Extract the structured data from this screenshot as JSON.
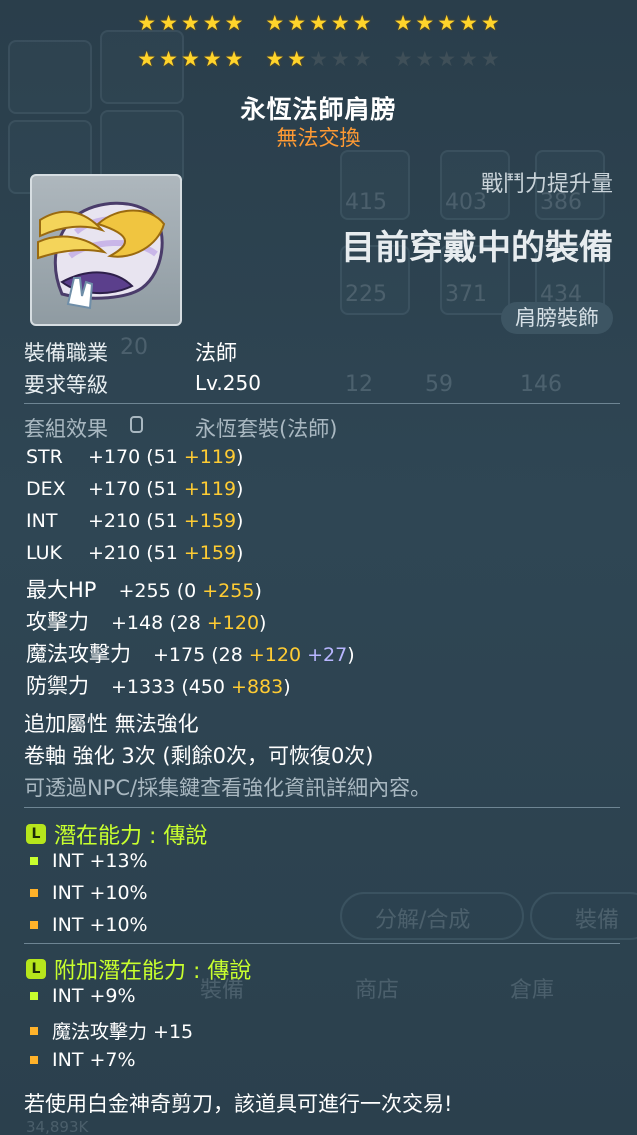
{
  "stars": {
    "filled": 22,
    "total": 30
  },
  "item": {
    "name": "永恆法師肩膀",
    "trade_status": "無法交換"
  },
  "combat": {
    "title": "戰鬥力提升量",
    "equipped_label": "目前穿戴中的裝備",
    "slot": "肩膀裝飾"
  },
  "requirements": {
    "job_label": "裝備職業",
    "job_value": "法師",
    "level_label": "要求等級",
    "level_value": "Lv.250"
  },
  "set": {
    "label": "套組效果",
    "value": "永恆套裝(法師)"
  },
  "stats": [
    {
      "name": "STR",
      "total": "+170",
      "base": "(51",
      "bonus": "+119",
      "extra": "",
      "close": ")"
    },
    {
      "name": "DEX",
      "total": "+170",
      "base": "(51",
      "bonus": "+119",
      "extra": "",
      "close": ")"
    },
    {
      "name": "INT",
      "total": "+210",
      "base": "(51",
      "bonus": "+159",
      "extra": "",
      "close": ")"
    },
    {
      "name": "LUK",
      "total": "+210",
      "base": "(51",
      "bonus": "+159",
      "extra": "",
      "close": ")"
    },
    {
      "name": "最大HP",
      "total": "+255",
      "base": "(0",
      "bonus": "+255",
      "extra": "",
      "close": ")"
    },
    {
      "name": "攻擊力",
      "total": "+148",
      "base": "(28",
      "bonus": "+120",
      "extra": "",
      "close": ")"
    },
    {
      "name": "魔法攻擊力",
      "total": "+175",
      "base": "(28",
      "bonus": "+120",
      "extra": "+27",
      "close": ")"
    },
    {
      "name": "防禦力",
      "total": "+1333",
      "base": "(450",
      "bonus": "+883",
      "extra": "",
      "close": ")"
    }
  ],
  "extra_info": {
    "bonus_attr": "追加屬性 無法強化",
    "scroll": "卷軸 強化 3次 (剩餘0次，可恢復0次)",
    "hint": "可透過NPC/採集鍵查看強化資訊詳細內容。"
  },
  "potential": {
    "header": "潛在能力 : 傳說",
    "lines": [
      {
        "text": "INT +13%",
        "color": "#c8ff2e"
      },
      {
        "text": "INT +10%",
        "color": "#ffb22a"
      },
      {
        "text": "INT +10%",
        "color": "#ffb22a"
      }
    ]
  },
  "bonus_potential": {
    "header": "附加潛在能力 : 傳說",
    "lines": [
      {
        "text": "INT +9%",
        "color": "#c8ff2e"
      },
      {
        "text": "魔法攻擊力 +15",
        "color": "#ffb22a"
      },
      {
        "text": "INT +7%",
        "color": "#ffb22a"
      }
    ]
  },
  "footer": {
    "note": "若使用白金神奇剪刀，該道具可進行一次交易!"
  },
  "background": {
    "buttons": [
      "分解/合成",
      "裝備",
      "商店",
      "倉庫"
    ],
    "meso": "34,893K",
    "slots": [
      "415",
      "403",
      "386",
      "225",
      "371",
      "434",
      "12",
      "59",
      "146",
      "20"
    ]
  }
}
